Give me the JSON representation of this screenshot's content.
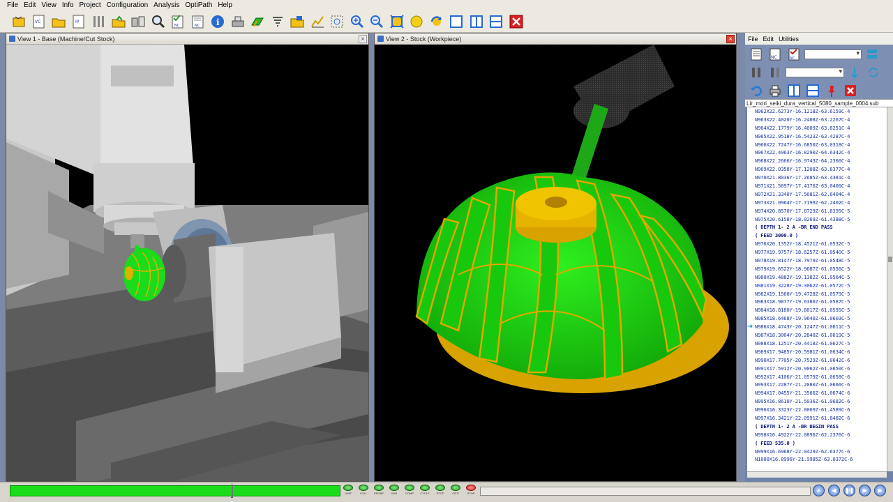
{
  "menu": [
    "File",
    "Edit",
    "View",
    "Info",
    "Project",
    "Configuration",
    "Analysis",
    "OptiPath",
    "Help"
  ],
  "toolbar": {
    "buttons": [
      "new-icon",
      "vc-icon",
      "open-folder-icon",
      "ip-icon",
      "setup-icon",
      "open-project-icon",
      "machine-icon",
      "zoom-icon",
      "nc-check-icon",
      "nc-file-icon",
      "info-icon",
      "fixture-icon",
      "stock-icon",
      "tool-icon",
      "folder-icon",
      "chart-icon",
      "zoom-box-icon",
      "zoom-in-icon",
      "zoom-out-icon",
      "fit-icon",
      "sphere-icon",
      "rotate-icon",
      "single-view-icon",
      "vertical-split-icon",
      "horizontal-split-icon",
      "close-icon"
    ]
  },
  "view1": {
    "title": "View 1 - Base (Machine/Cut Stock)",
    "close": "×"
  },
  "view2": {
    "title": "View 2 - Stock (Workpiece)",
    "close": "×"
  },
  "nc_panel": {
    "menu": [
      "File",
      "Edit",
      "Utilities"
    ],
    "file_name": "Lir_mori_seiki_dura_vertical_5080_sample_0004.sub",
    "combo1": "",
    "combo2": "",
    "lines": [
      {
        "text": "N962X22.6273Y-16.1218Z-63.6159C-4",
        "type": "code"
      },
      {
        "text": "N963X22.4020Y-16.2408Z-63.2267C-4",
        "type": "code"
      },
      {
        "text": "N964X22.1779Y-16.4009Z-63.8251C-4",
        "type": "code"
      },
      {
        "text": "N965X22.9518Y-16.5423Z-63.4287C-4",
        "type": "code"
      },
      {
        "text": "N966X22.7247Y-16.6850Z-63.0318C-4",
        "type": "code"
      },
      {
        "text": "N967X22.4963Y-16.8290Z-64.6342C-4",
        "type": "code"
      },
      {
        "text": "N968X22.2666Y-16.9743Z-64.2360C-4",
        "type": "code"
      },
      {
        "text": "N969X22.0358Y-17.1208Z-63.8377C-4",
        "type": "code"
      },
      {
        "text": "N970X21.8036Y-17.2685Z-63.4381C-4",
        "type": "code"
      },
      {
        "text": "N971X21.5697Y-17.4176Z-63.0400C-4",
        "type": "code"
      },
      {
        "text": "N972X21.3340Y-17.5681Z-62.6404C-4",
        "type": "code"
      },
      {
        "text": "N973X21.0964Y-17.7199Z-62.2402C-4",
        "type": "code"
      },
      {
        "text": "N974X20.8570Y-17.8729Z-61.8395C-5",
        "type": "code"
      },
      {
        "text": "N975X20.6158Y-18.0269Z-61.4388C-5",
        "type": "code"
      },
      {
        "text": "( DEPTH   1-  2 A -BR END PASS",
        "type": "comment"
      },
      {
        "text": "( FEED  3000.0 )",
        "type": "comment"
      },
      {
        "text": "N976X20.1352Y-18.4521Z-61.0532C-5",
        "type": "code"
      },
      {
        "text": "N977X19.9757Y-18.6257Z-61.0540C-5",
        "type": "code"
      },
      {
        "text": "N978X19.8147Y-18.7979Z-61.0548C-5",
        "type": "code"
      },
      {
        "text": "N979X19.6522Y-18.9687Z-61.0556C-5",
        "type": "code"
      },
      {
        "text": "N980X19.4882Y-19.1382Z-61.0564C-5",
        "type": "code"
      },
      {
        "text": "N981X19.3228Y-19.3062Z-61.0572C-5",
        "type": "current"
      },
      {
        "text": "N982X19.1560Y-19.4728Z-61.0579C-5",
        "type": "code"
      },
      {
        "text": "N983X18.9877Y-19.6380Z-61.0587C-5",
        "type": "code"
      },
      {
        "text": "N984X18.8180Y-19.8017Z-61.0595C-5",
        "type": "code"
      },
      {
        "text": "N985X18.6468Y-19.9640Z-61.0603C-5",
        "type": "code"
      },
      {
        "text": "N986X18.4743Y-20.1247Z-61.0611C-5",
        "type": "code"
      },
      {
        "text": "N987X18.3004Y-20.2840Z-61.0619C-5",
        "type": "code"
      },
      {
        "text": "N988X18.1251Y-20.4418Z-61.0627C-5",
        "type": "code"
      },
      {
        "text": "N989X17.9485Y-20.5981Z-61.0634C-6",
        "type": "code"
      },
      {
        "text": "N990X17.7705Y-20.7529Z-61.0642C-6",
        "type": "code"
      },
      {
        "text": "N991X17.5912Y-20.9062Z-61.0650C-6",
        "type": "code"
      },
      {
        "text": "N992X17.4106Y-21.0579Z-61.0658C-6",
        "type": "code"
      },
      {
        "text": "N993X17.2287Y-21.2080Z-61.0666C-6",
        "type": "code"
      },
      {
        "text": "N994X17.0455Y-21.3566Z-61.0674C-6",
        "type": "code"
      },
      {
        "text": "N995X16.8610Y-21.5036Z-61.0682C-6",
        "type": "code"
      },
      {
        "text": "N996X16.3323Y-22.0069Z-61.4589C-6",
        "type": "code"
      },
      {
        "text": "N997X16.3421Y-22.0991Z-61.8482C-6",
        "type": "code"
      },
      {
        "text": "( DEPTH   1-  2 A -BR BEGIN PASS",
        "type": "comment"
      },
      {
        "text": "N998X16.4922Y-22.0896Z-62.2376C-6",
        "type": "code"
      },
      {
        "text": "( FEED   535.0 )",
        "type": "comment"
      },
      {
        "text": "N999X16.6968Y-22.0429Z-62.6377C-6",
        "type": "code"
      },
      {
        "text": "N1000X16.8996Y-21.9985Z-63.0372C-6",
        "type": "code"
      }
    ]
  },
  "status": {
    "progress": 1.0,
    "knob_fraction": 0.67,
    "leds": [
      {
        "label": "LIMIT",
        "color": "green"
      },
      {
        "label": "COLL",
        "color": "green"
      },
      {
        "label": "PROBE",
        "color": "green"
      },
      {
        "label": "SUB",
        "color": "green"
      },
      {
        "label": "COMP",
        "color": "green"
      },
      {
        "label": "CYCLE",
        "color": "green"
      },
      {
        "label": "RTCP",
        "color": "green"
      },
      {
        "label": "OPTI",
        "color": "green"
      },
      {
        "label": "STOP",
        "color": "red"
      }
    ],
    "controls": [
      "rewind-icon",
      "step-back-icon",
      "pause-icon",
      "step-forward-icon",
      "play-icon"
    ]
  },
  "colors": {
    "impeller": "#22e012",
    "hub": "#e8b000",
    "background": "#000000",
    "machine": "#cfcfcf"
  }
}
